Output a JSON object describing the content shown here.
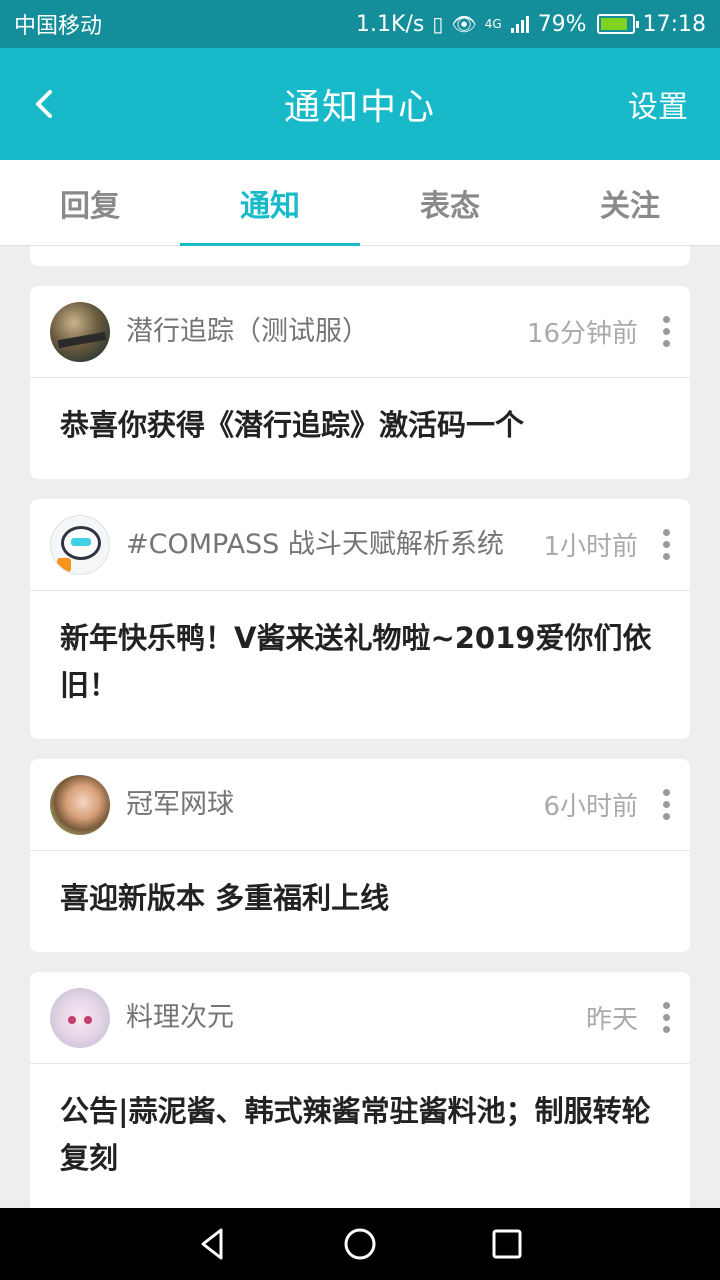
{
  "status_bar": {
    "carrier": "中国移动",
    "speed": "1.1K/s",
    "signal": "4G",
    "battery": "79%",
    "time": "17:18"
  },
  "header": {
    "title": "通知中心",
    "settings_label": "设置",
    "back_icon": "chevron-left-icon"
  },
  "tabs": [
    {
      "label": "回复",
      "active": false
    },
    {
      "label": "通知",
      "active": true
    },
    {
      "label": "表态",
      "active": false
    },
    {
      "label": "关注",
      "active": false
    }
  ],
  "notifications": [
    {
      "source": "潜行追踪（测试服）",
      "time": "16分钟前",
      "message": "恭喜你获得《潜行追踪》激活码一个"
    },
    {
      "source": "#COMPASS 战斗天赋解析系统",
      "time": "1小时前",
      "message": "新年快乐鸭！V酱来送礼物啦~2019爱你们依旧！"
    },
    {
      "source": "冠军网球",
      "time": "6小时前",
      "message": "喜迎新版本 多重福利上线"
    },
    {
      "source": "料理次元",
      "time": "昨天",
      "message": "公告|蒜泥酱、韩式辣酱常驻酱料池；制服转轮复刻"
    }
  ],
  "colors": {
    "accent": "#18b9c9",
    "status_bar": "#138e9a"
  }
}
